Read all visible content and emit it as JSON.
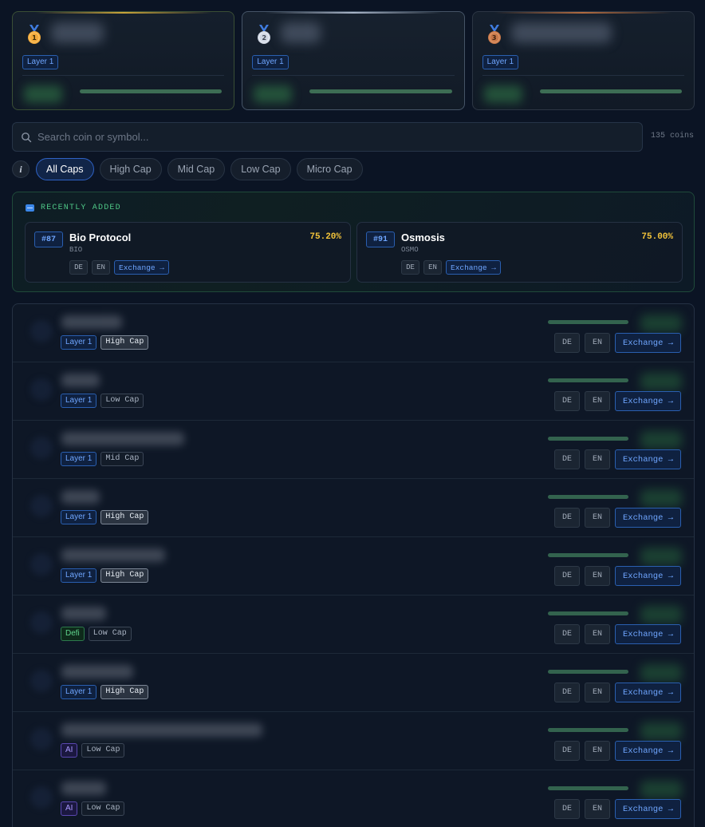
{
  "top_cards": [
    {
      "rank": "1",
      "tag": "Layer 1",
      "medal_color": "#f2a93b"
    },
    {
      "rank": "2",
      "tag": "Layer 1",
      "medal_color": "#cfd6e2"
    },
    {
      "rank": "3",
      "tag": "Layer 1",
      "medal_color": "#c9794a"
    }
  ],
  "search": {
    "placeholder": "Search coin or symbol..."
  },
  "coin_count": "135 coins",
  "info_label": "i",
  "filters": [
    {
      "label": "All Caps",
      "active": true
    },
    {
      "label": "High Cap",
      "active": false
    },
    {
      "label": "Mid Cap",
      "active": false
    },
    {
      "label": "Low Cap",
      "active": false
    },
    {
      "label": "Micro Cap",
      "active": false
    }
  ],
  "recently_added": {
    "title": "RECENTLY ADDED",
    "items": [
      {
        "rank": "#87",
        "name": "Bio Protocol",
        "symbol": "BIO",
        "pct": "75.20%",
        "lang1": "DE",
        "lang2": "EN",
        "exchange": "Exchange →"
      },
      {
        "rank": "#91",
        "name": "Osmosis",
        "symbol": "OSMO",
        "pct": "75.00%",
        "lang1": "DE",
        "lang2": "EN",
        "exchange": "Exchange →"
      }
    ]
  },
  "rows": [
    {
      "category": "Layer 1",
      "category_color": "blue",
      "cap": "High Cap",
      "cap_strong": true,
      "lang1": "DE",
      "lang2": "EN",
      "exchange": "Exchange →"
    },
    {
      "category": "Layer 1",
      "category_color": "blue",
      "cap": "Low Cap",
      "cap_strong": false,
      "lang1": "DE",
      "lang2": "EN",
      "exchange": "Exchange →"
    },
    {
      "category": "Layer 1",
      "category_color": "blue",
      "cap": "Mid Cap",
      "cap_strong": false,
      "lang1": "DE",
      "lang2": "EN",
      "exchange": "Exchange →"
    },
    {
      "category": "Layer 1",
      "category_color": "blue",
      "cap": "High Cap",
      "cap_strong": true,
      "lang1": "DE",
      "lang2": "EN",
      "exchange": "Exchange →"
    },
    {
      "category": "Layer 1",
      "category_color": "blue",
      "cap": "High Cap",
      "cap_strong": true,
      "lang1": "DE",
      "lang2": "EN",
      "exchange": "Exchange →"
    },
    {
      "category": "Defi",
      "category_color": "green",
      "cap": "Low Cap",
      "cap_strong": false,
      "lang1": "DE",
      "lang2": "EN",
      "exchange": "Exchange →"
    },
    {
      "category": "Layer 1",
      "category_color": "blue",
      "cap": "High Cap",
      "cap_strong": true,
      "lang1": "DE",
      "lang2": "EN",
      "exchange": "Exchange →"
    },
    {
      "category": "AI",
      "category_color": "purple",
      "cap": "Low Cap",
      "cap_strong": false,
      "lang1": "DE",
      "lang2": "EN",
      "exchange": "Exchange →"
    },
    {
      "category": "AI",
      "category_color": "purple",
      "cap": "Low Cap",
      "cap_strong": false,
      "lang1": "DE",
      "lang2": "EN",
      "exchange": "Exchange →"
    }
  ]
}
